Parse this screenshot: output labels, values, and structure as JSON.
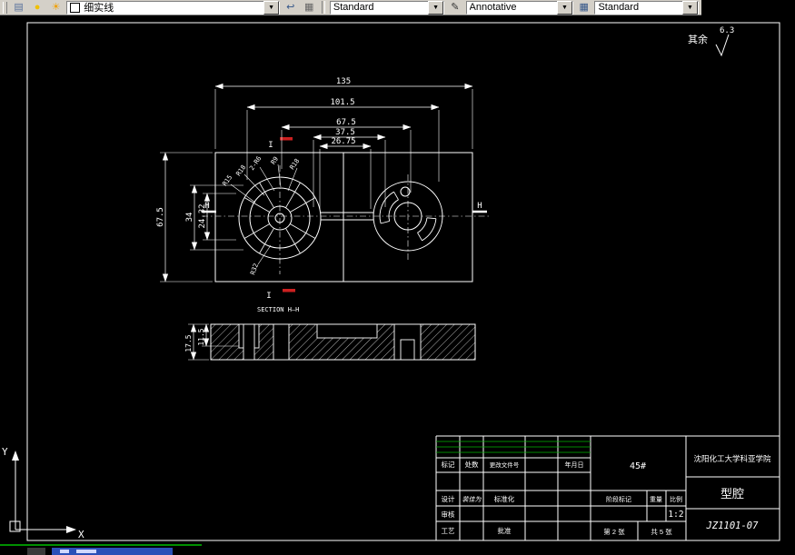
{
  "toolbar": {
    "layer_value": "细实线",
    "text_style_value": "Standard",
    "dim_style_value": "Annotative",
    "table_style_value": "Standard"
  },
  "surface_note": {
    "prefix": "其余",
    "roughness": "6.3"
  },
  "plan": {
    "dims_top": [
      "135",
      "101.5",
      "67.5",
      "37.5",
      "26.75"
    ],
    "dims_left": [
      "67.5",
      "34",
      "24.32"
    ],
    "radius_labels": [
      "R15",
      "R18",
      "2-R6",
      "R9",
      "R18",
      "R32"
    ],
    "section_marks": {
      "h": "H",
      "i": "I"
    }
  },
  "section": {
    "label": "SECTION H—H",
    "dims": [
      "17.5",
      "11.5"
    ]
  },
  "title_block": {
    "school": "沈阳化工大学科亚学院",
    "part_name": "型腔",
    "drawing_no": "JZ1101-07",
    "material": "45#",
    "scale": "1:2",
    "sheet_no": "第 2 张",
    "sheet_total": "共 5 张",
    "col_mark": "标记",
    "col_count": "处数",
    "col_docno": "更改文件号",
    "col_date": "年月日",
    "row_design": "设计",
    "row_standard": "标准化",
    "row_check": "审核",
    "row_process": "工艺",
    "row_approve": "批准",
    "stage_mark": "阶段标记",
    "weight": "重量",
    "ratio": "比例",
    "designer": "裴佳为"
  },
  "ucs": {
    "x_label": "X",
    "y_label": "Y"
  }
}
